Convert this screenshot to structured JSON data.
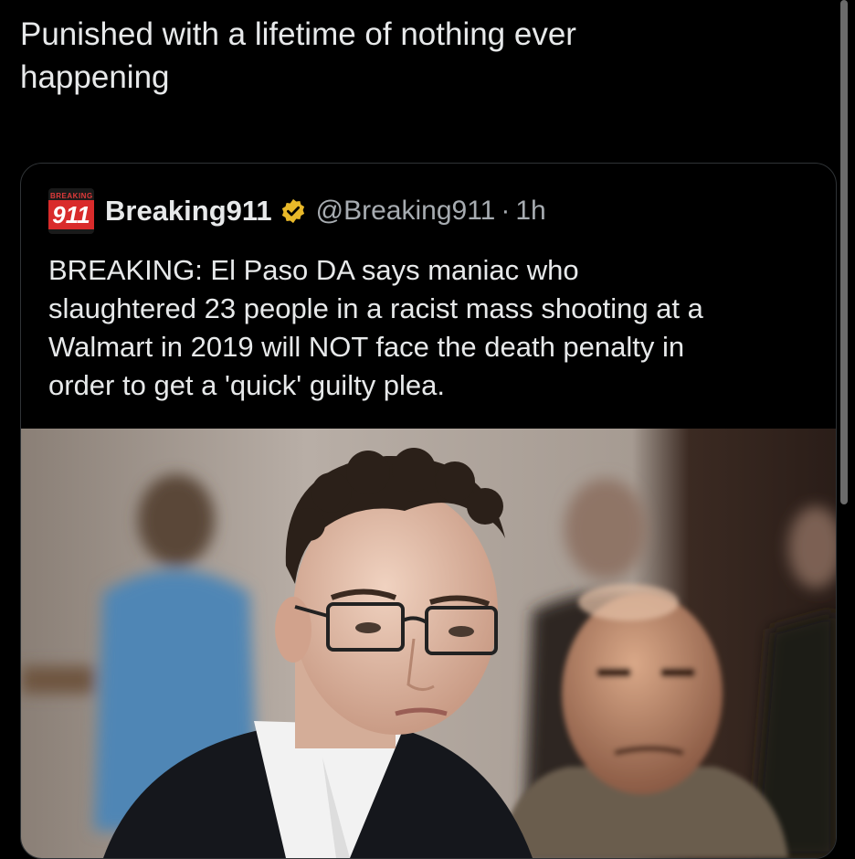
{
  "post": {
    "text": "Punished with a lifetime of nothing ever\nhappening"
  },
  "quoted_post": {
    "avatar": {
      "top_text": "BREAKING",
      "number": "911"
    },
    "display_name": "Breaking911",
    "verified_badge_icon": "gold-verified-badge",
    "handle": "@Breaking911",
    "separator": "·",
    "time": "1h",
    "text": "BREAKING: El Paso DA says maniac who\nslaughtered 23 people in a racist mass shooting at a\nWalmart in 2019 will NOT face the death penalty in\norder to get a 'quick' guilty plea."
  },
  "colors": {
    "background": "#000000",
    "text": "#e7e9ea",
    "secondary_text": "#a7acb1",
    "badge_gold": "#e8b829",
    "brand_red": "#d92b2b"
  }
}
